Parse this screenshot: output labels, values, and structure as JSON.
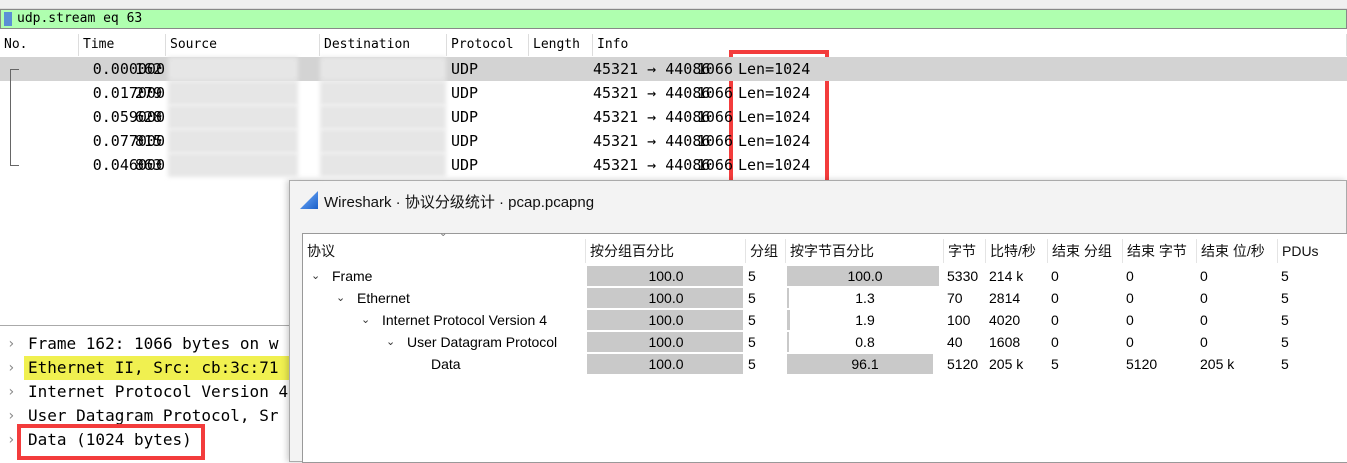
{
  "filter": {
    "value": "udp.stream eq 63"
  },
  "packet_list": {
    "columns": [
      "No.",
      "Time",
      "Source",
      "Destination",
      "Protocol",
      "Length",
      "Info"
    ],
    "rows": [
      {
        "no": "162",
        "time": "0.000000",
        "protocol": "UDP",
        "length": "1066",
        "info": "45321 → 44086",
        "len": "Len=1024"
      },
      {
        "no": "279",
        "time": "0.017000",
        "protocol": "UDP",
        "length": "1066",
        "info": "45321 → 44086",
        "len": "Len=1024"
      },
      {
        "no": "628",
        "time": "0.059000",
        "protocol": "UDP",
        "length": "1066",
        "info": "45321 → 44086",
        "len": "Len=1024"
      },
      {
        "no": "815",
        "time": "0.077000",
        "protocol": "UDP",
        "length": "1066",
        "info": "45321 → 44086",
        "len": "Len=1024"
      },
      {
        "no": "863",
        "time": "0.046000",
        "protocol": "UDP",
        "length": "1066",
        "info": "45321 → 44086",
        "len": "Len=1024"
      }
    ]
  },
  "details": [
    "Frame 162: 1066 bytes on w",
    "Ethernet II, Src: cb:3c:71",
    "Internet Protocol Version 4",
    "User Datagram Protocol, Sr",
    "Data (1024 bytes)"
  ],
  "dialog": {
    "title": "Wireshark · 协议分级统计 · pcap.pcapng",
    "columns": [
      "协议",
      "按分组百分比",
      "分组",
      "按字节百分比",
      "字节",
      "比特/秒",
      "结束 分组",
      "结束 字节",
      "结束 位/秒",
      "PDUs"
    ],
    "rows": [
      {
        "name": "Frame",
        "pkt_pct": "100.0",
        "pkts": "5",
        "byte_pct": "100.0",
        "bytes": "5330",
        "bps": "214 k",
        "end_pkts": "0",
        "end_bytes": "0",
        "end_bps": "0",
        "pdus": "5",
        "pkt_frac": 1.0,
        "byte_frac": 1.0
      },
      {
        "name": "Ethernet",
        "pkt_pct": "100.0",
        "pkts": "5",
        "byte_pct": "1.3",
        "bytes": "70",
        "bps": "2814",
        "end_pkts": "0",
        "end_bytes": "0",
        "end_bps": "0",
        "pdus": "5",
        "pkt_frac": 1.0,
        "byte_frac": 0.013
      },
      {
        "name": "Internet Protocol Version 4",
        "pkt_pct": "100.0",
        "pkts": "5",
        "byte_pct": "1.9",
        "bytes": "100",
        "bps": "4020",
        "end_pkts": "0",
        "end_bytes": "0",
        "end_bps": "0",
        "pdus": "5",
        "pkt_frac": 1.0,
        "byte_frac": 0.019
      },
      {
        "name": "User Datagram Protocol",
        "pkt_pct": "100.0",
        "pkts": "5",
        "byte_pct": "0.8",
        "bytes": "40",
        "bps": "1608",
        "end_pkts": "0",
        "end_bytes": "0",
        "end_bps": "0",
        "pdus": "5",
        "pkt_frac": 1.0,
        "byte_frac": 0.008
      },
      {
        "name": "Data",
        "pkt_pct": "100.0",
        "pkts": "5",
        "byte_pct": "96.1",
        "bytes": "5120",
        "bps": "205 k",
        "end_pkts": "5",
        "end_bytes": "5120",
        "end_bps": "205 k",
        "pdus": "5",
        "pkt_frac": 1.0,
        "byte_frac": 0.961
      }
    ]
  }
}
